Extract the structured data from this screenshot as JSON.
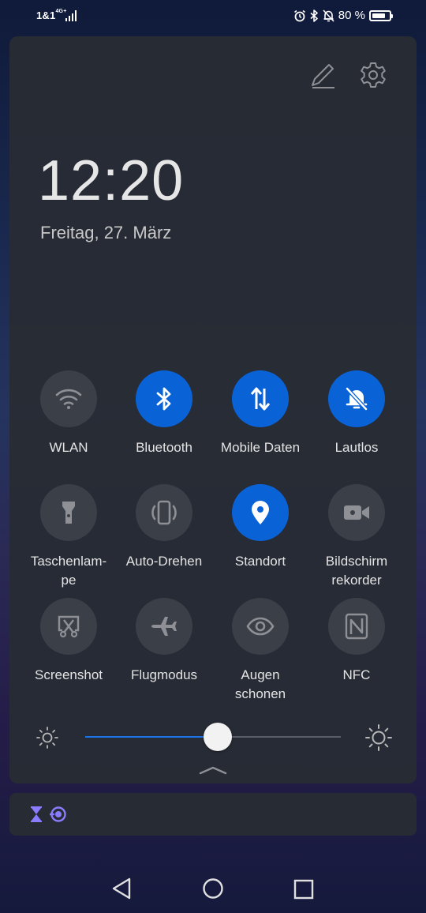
{
  "status_bar": {
    "carrier": "1&1",
    "network": "4G",
    "network_suffix": "+",
    "battery_text": "80 %",
    "battery_level": 0.8,
    "icons": [
      "alarm-icon",
      "bluetooth-icon",
      "mute-icon",
      "battery-icon"
    ]
  },
  "header": {
    "edit_icon": "pencil-icon",
    "settings_icon": "gear-icon"
  },
  "clock": {
    "time": "12:20",
    "date": "Freitag, 27. März"
  },
  "tiles": [
    {
      "label": "WLAN",
      "icon": "wifi-icon",
      "active": false
    },
    {
      "label": "Bluetooth",
      "icon": "bluetooth-icon",
      "active": true
    },
    {
      "label": "Mobile Daten",
      "icon": "mobile-data-icon",
      "active": true
    },
    {
      "label": "Lautlos",
      "icon": "mute-bell-icon",
      "active": true
    },
    {
      "label": "Taschenlam-\npe",
      "icon": "flashlight-icon",
      "active": false
    },
    {
      "label": "Auto-Drehen",
      "icon": "auto-rotate-icon",
      "active": false
    },
    {
      "label": "Standort",
      "icon": "location-icon",
      "active": true
    },
    {
      "label": "Bildschirm\nrekorder",
      "icon": "screen-recorder-icon",
      "active": false
    },
    {
      "label": "Screenshot",
      "icon": "screenshot-icon",
      "active": false
    },
    {
      "label": "Flugmodus",
      "icon": "airplane-icon",
      "active": false
    },
    {
      "label": "Augen\nschonen",
      "icon": "eye-icon",
      "active": false
    },
    {
      "label": "NFC",
      "icon": "nfc-icon",
      "active": false
    }
  ],
  "brightness": {
    "level": 0.52,
    "accent": "#1a73e8"
  },
  "notifications": {
    "icons": [
      "hourglass-icon",
      "sync-icon"
    ],
    "accent": "#8a7cff"
  },
  "colors": {
    "active_tile": "#0a63d6",
    "inactive_tile": "#3b3f47"
  },
  "nav_bar": {
    "buttons": [
      "back-icon",
      "home-icon",
      "recents-icon"
    ]
  }
}
